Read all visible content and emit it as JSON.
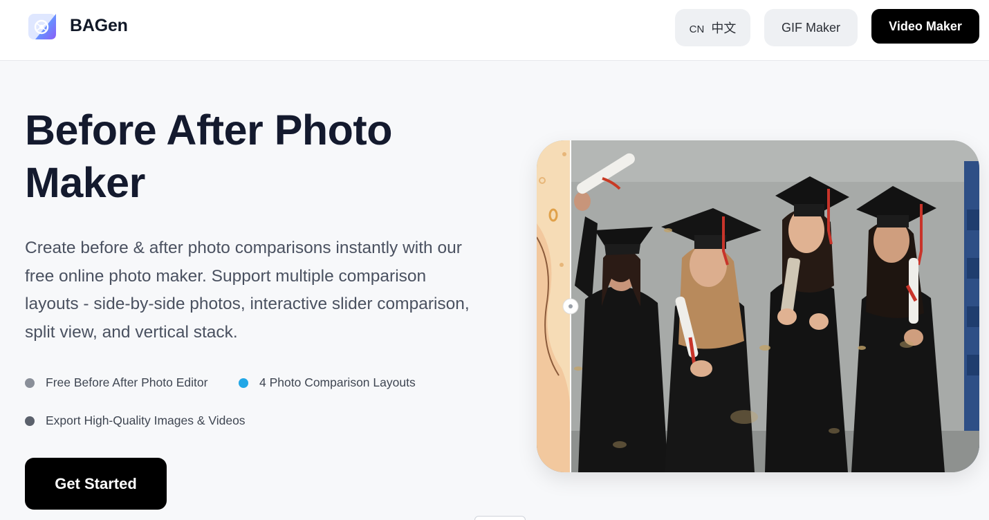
{
  "header": {
    "brand": "BAGen",
    "lang_code": "CN",
    "lang_label": "中文",
    "gif_maker_label": "GIF Maker",
    "video_maker_label": "Video Maker"
  },
  "hero": {
    "title": "Before After Photo Maker",
    "description": "Create before & after photo comparisons instantly with our free online photo maker. Support multiple comparison layouts - side-by-side photos, interactive slider comparison, split view, and vertical stack.",
    "features": [
      {
        "label": "Free Before After Photo Editor",
        "dot_color": "#8a8f99"
      },
      {
        "label": "4 Photo Comparison Layouts",
        "dot_color": "#22a7e6"
      },
      {
        "label": "Export High-Quality Images & Videos",
        "dot_color": "#5b616c"
      }
    ],
    "cta_label": "Get Started"
  },
  "comparison": {
    "before_image": "illustrated-graduates",
    "after_image": "graduates-photo",
    "slider_position": 0.077
  },
  "colors": {
    "accent": "#000000",
    "title": "#141a2e",
    "body_text": "#4a5160",
    "header_bg": "#ffffff",
    "page_bg": "#f7f8fa"
  }
}
